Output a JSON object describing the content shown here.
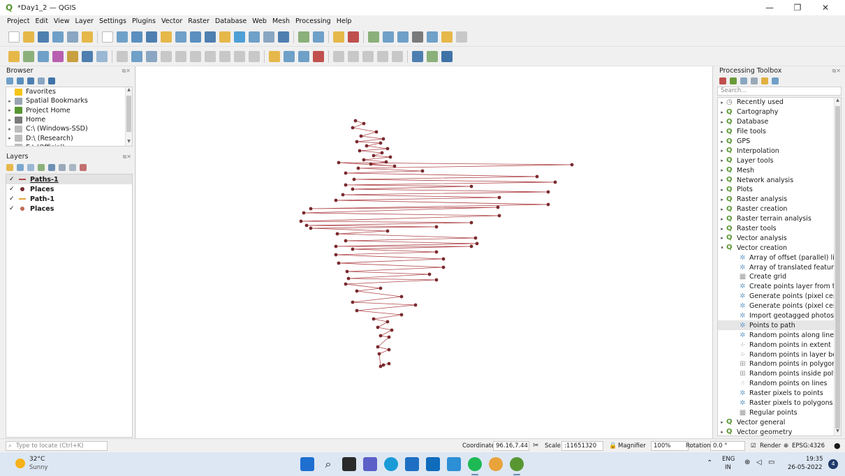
{
  "window": {
    "title": "*Day1_2 — QGIS",
    "minimize": "—",
    "maximize": "❐",
    "close": "✕"
  },
  "menu": [
    "Project",
    "Edit",
    "View",
    "Layer",
    "Settings",
    "Plugins",
    "Vector",
    "Raster",
    "Database",
    "Web",
    "Mesh",
    "Processing",
    "Help"
  ],
  "browser": {
    "title": "Browser",
    "items": [
      {
        "label": "Favorites",
        "icon": "star-icon",
        "color": "#f5c518",
        "expand": ""
      },
      {
        "label": "Spatial Bookmarks",
        "icon": "bookmark-icon",
        "color": "#9aa5b1",
        "expand": "▸"
      },
      {
        "label": "Project Home",
        "icon": "project-home-icon",
        "color": "#589632",
        "expand": "▸"
      },
      {
        "label": "Home",
        "icon": "home-icon",
        "color": "#7a7a7a",
        "expand": "▸"
      },
      {
        "label": "C:\\ (Windows-SSD)",
        "icon": "drive-icon",
        "color": "#bdbdbd",
        "expand": "▸"
      },
      {
        "label": "D:\\ (Research)",
        "icon": "drive-icon",
        "color": "#bdbdbd",
        "expand": "▸"
      },
      {
        "label": "E:\\ (Official)",
        "icon": "drive-icon",
        "color": "#bdbdbd",
        "expand": "▸"
      }
    ]
  },
  "layers": {
    "title": "Layers",
    "items": [
      {
        "label": "Paths-1",
        "type": "line",
        "color": "#b0464a",
        "checked": "✓",
        "selected": true,
        "underline": true
      },
      {
        "label": "Places",
        "type": "point",
        "color": "#7a2a2e",
        "checked": "✓",
        "selected": false,
        "underline": false
      },
      {
        "label": "Path-1",
        "type": "line",
        "color": "#e8a33a",
        "checked": "✓",
        "selected": false,
        "underline": false
      },
      {
        "label": "Places",
        "type": "point",
        "color": "#c06a52",
        "checked": "✓",
        "selected": false,
        "underline": false
      }
    ]
  },
  "toolbox": {
    "title": "Processing Toolbox",
    "search_placeholder": "Search...",
    "categories_before": [
      {
        "label": "Recently used",
        "icon": "clock-icon"
      },
      {
        "label": "Cartography",
        "icon": "qgis-icon"
      },
      {
        "label": "Database",
        "icon": "qgis-icon"
      },
      {
        "label": "File tools",
        "icon": "qgis-icon"
      },
      {
        "label": "GPS",
        "icon": "qgis-icon"
      },
      {
        "label": "Interpolation",
        "icon": "qgis-icon"
      },
      {
        "label": "Layer tools",
        "icon": "qgis-icon"
      },
      {
        "label": "Mesh",
        "icon": "qgis-icon"
      },
      {
        "label": "Network analysis",
        "icon": "qgis-icon"
      },
      {
        "label": "Plots",
        "icon": "qgis-icon"
      },
      {
        "label": "Raster analysis",
        "icon": "qgis-icon"
      },
      {
        "label": "Raster creation",
        "icon": "qgis-icon"
      },
      {
        "label": "Raster terrain analysis",
        "icon": "qgis-icon"
      },
      {
        "label": "Raster tools",
        "icon": "qgis-icon"
      },
      {
        "label": "Vector analysis",
        "icon": "qgis-icon"
      }
    ],
    "expanded_category": "Vector creation",
    "algorithms": [
      {
        "label": "Array of offset (parallel) lines",
        "icon": "gear-icon",
        "selected": false
      },
      {
        "label": "Array of translated features",
        "icon": "gear-icon",
        "selected": false
      },
      {
        "label": "Create grid",
        "icon": "grid-icon",
        "selected": false
      },
      {
        "label": "Create points layer from ta...",
        "icon": "gear-icon",
        "selected": false
      },
      {
        "label": "Generate points (pixel centr...",
        "icon": "gear-icon",
        "selected": false
      },
      {
        "label": "Generate points (pixel centr...",
        "icon": "gear-icon",
        "selected": false
      },
      {
        "label": "Import geotagged photos",
        "icon": "gear-icon",
        "selected": false
      },
      {
        "label": "Points to path",
        "icon": "gear-icon",
        "selected": true
      },
      {
        "label": "Random points along line",
        "icon": "gear-icon",
        "selected": false
      },
      {
        "label": "Random points in extent",
        "icon": "dots-icon",
        "selected": false
      },
      {
        "label": "Random points in layer bou...",
        "icon": "dots-icon",
        "selected": false
      },
      {
        "label": "Random points in polygons",
        "icon": "polygon-points-icon",
        "selected": false
      },
      {
        "label": "Random points inside poly...",
        "icon": "polygon-points-icon",
        "selected": false
      },
      {
        "label": "Random points on lines",
        "icon": "line-points-icon",
        "selected": false
      },
      {
        "label": "Raster pixels to points",
        "icon": "gear-icon",
        "selected": false
      },
      {
        "label": "Raster pixels to polygons",
        "icon": "gear-icon",
        "selected": false
      },
      {
        "label": "Regular points",
        "icon": "grid-icon",
        "selected": false
      }
    ],
    "categories_after": [
      {
        "label": "Vector general",
        "icon": "qgis-icon"
      },
      {
        "label": "Vector geometry",
        "icon": "qgis-icon"
      }
    ]
  },
  "status": {
    "locate_placeholder": "Type to locate (Ctrl+K)",
    "coordinate_label": "Coordinate",
    "coordinate_value": "96.16,7.44",
    "scale_label": "Scale",
    "scale_value": ":11651320",
    "magnifier_label": "Magnifier",
    "magnifier_value": "100%",
    "rotation_label": "Rotation",
    "rotation_value": "0.0 °",
    "render_label": "Render",
    "crs": "EPSG:4326"
  },
  "taskbar": {
    "temperature": "32°C",
    "weather": "Sunny",
    "lang_top": "ENG",
    "lang_bottom": "IN",
    "time": "19:35",
    "date": "26-05-2022",
    "notifications": "4"
  },
  "map_style": {
    "line_color": "#b0464a",
    "point_color": "#7a2a2e"
  }
}
